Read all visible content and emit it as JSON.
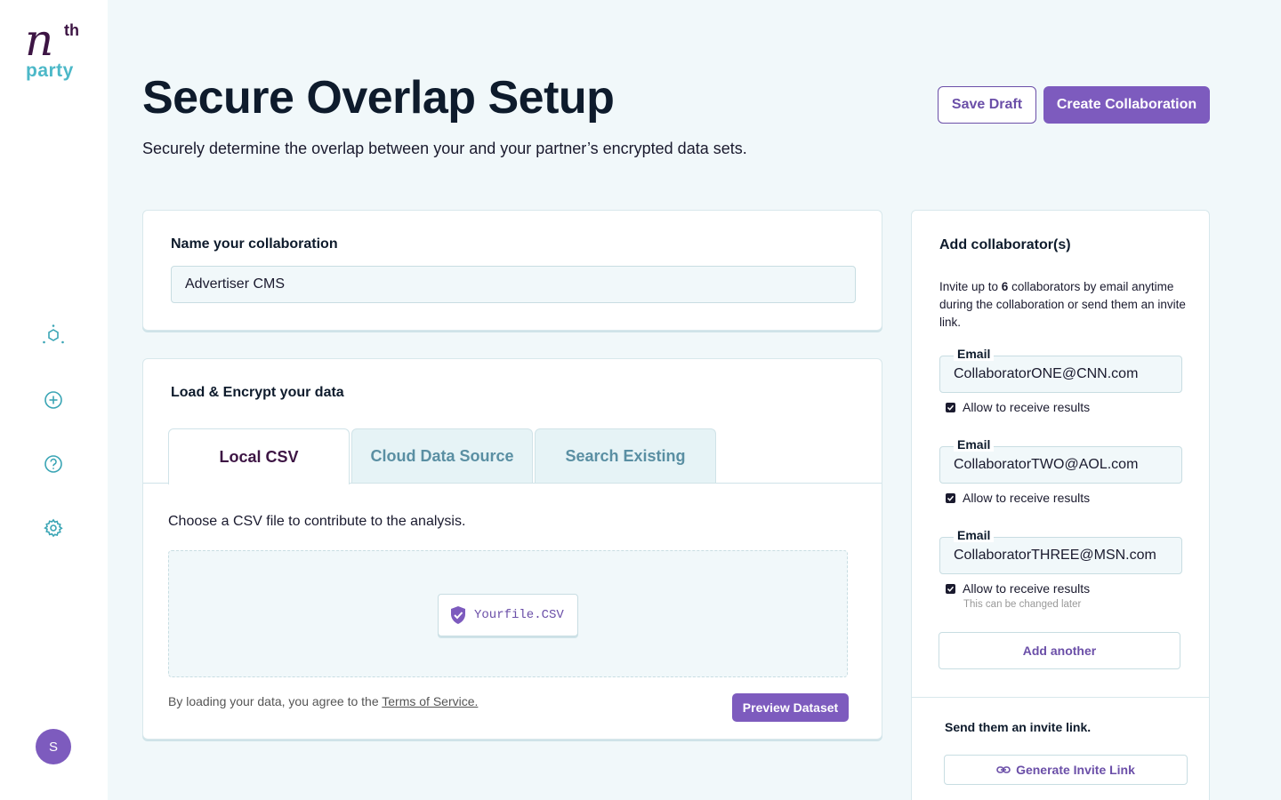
{
  "brand": {
    "logo_main": "n",
    "logo_sup": "th",
    "logo_sub": "party"
  },
  "sidebar": {
    "avatar_initial": "S"
  },
  "header": {
    "title": "Secure Overlap Setup",
    "subtitle": "Securely determine the overlap between your and your partner’s encrypted data sets.",
    "save_label": "Save Draft",
    "create_label": "Create Collaboration"
  },
  "name_card": {
    "label": "Name your collaboration",
    "value": "Advertiser CMS"
  },
  "load_card": {
    "label": "Load & Encrypt your data",
    "tabs": [
      {
        "label": "Local CSV"
      },
      {
        "label": "Cloud Data Source"
      },
      {
        "label": "Search Existing"
      }
    ],
    "instruction": "Choose a CSV file to contribute to the analysis.",
    "file_name": "Yourfile.CSV",
    "terms_prefix": "By loading your data, you agree to the ",
    "terms_link": "Terms of Service.",
    "preview_label": "Preview Dataset"
  },
  "collab_card": {
    "title": "Add collaborator(s)",
    "desc_pre": "Invite up to ",
    "desc_count": "6",
    "desc_post": " collaborators by email anytime during the collaboration or send them an invite link.",
    "collaborators": [
      {
        "label": "Email",
        "value": "CollaboratorONE@CNN.com",
        "checkbox_label": "Allow to receive results"
      },
      {
        "label": "Email",
        "value": "CollaboratorTWO@AOL.com",
        "checkbox_label": "Allow to receive results"
      },
      {
        "label": "Email",
        "value": "CollaboratorTHREE@MSN.com",
        "checkbox_label": "Allow to receive results"
      }
    ],
    "hint": "This can be changed later",
    "add_another_label": "Add another",
    "invite_title": "Send them an invite link.",
    "generate_label": "Generate Invite Link"
  },
  "colors": {
    "accent": "#7d5bbe",
    "brand_dark": "#3d1544",
    "brand_teal": "#4cb8c8",
    "icon_teal": "#3aa5b5"
  }
}
